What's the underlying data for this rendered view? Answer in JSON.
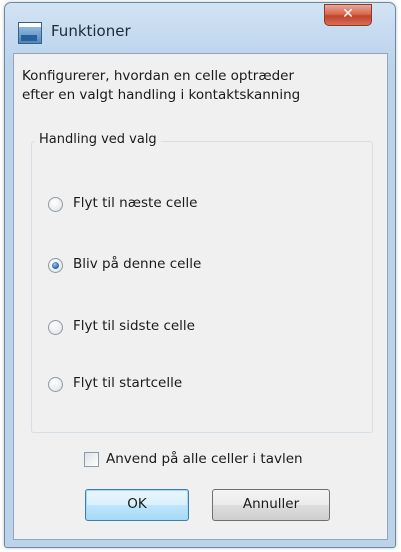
{
  "window": {
    "title": "Funktioner",
    "close_glyph": "✕"
  },
  "dialog": {
    "description_line1": "Konfigurerer, hvordan en celle optræder",
    "description_line2": "efter en valgt handling i kontaktskanning",
    "group_title": "Handling ved valg",
    "options": [
      {
        "label": "Flyt til næste celle",
        "checked": false
      },
      {
        "label": "Bliv på denne celle",
        "checked": true
      },
      {
        "label": "Flyt til sidste celle",
        "checked": false
      },
      {
        "label": "Flyt til startcelle",
        "checked": false
      }
    ],
    "apply_all_label": "Anvend på alle celler i tavlen",
    "apply_all_checked": false,
    "ok_label": "OK",
    "cancel_label": "Annuller"
  },
  "icons": {
    "app": "app-window-icon",
    "close": "close-icon"
  },
  "colors": {
    "title_bar": "#c2d8ee",
    "close_button": "#c0432a",
    "dialog_background": "#f0f0f0",
    "radio_selected": "#2d6bb2"
  }
}
